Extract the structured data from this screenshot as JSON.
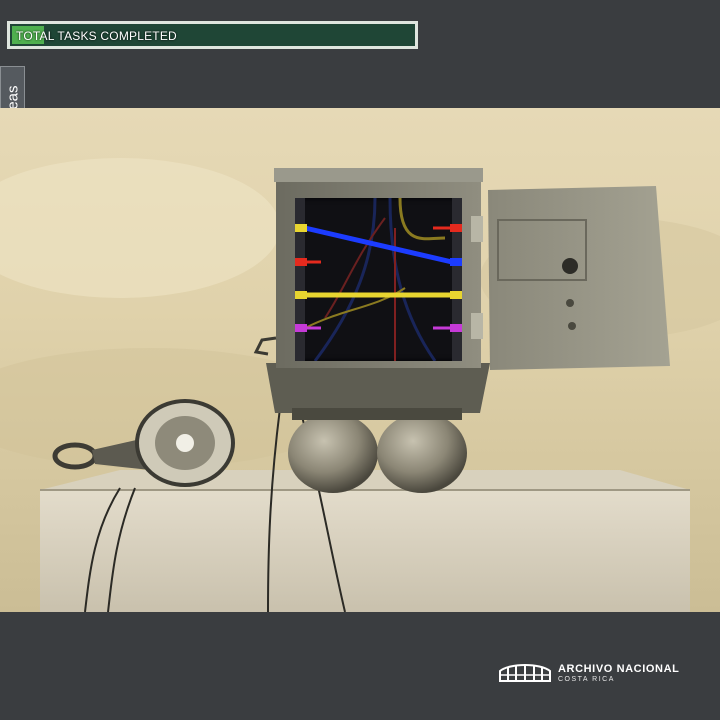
{
  "header": {
    "progress_label": "TOTAL TASKS COMPLETED",
    "progress_fraction": 0.08
  },
  "sidebar": {
    "tab_label": "Tareas"
  },
  "task": {
    "wires": [
      {
        "color": "#1c3cff",
        "from": "left-1",
        "to": "right-2"
      },
      {
        "color": "#e8d530",
        "from": "left-3",
        "to": "right-3"
      }
    ],
    "left_connector_colors": [
      "#e8d530",
      "#e52a1e",
      "#e8d530",
      "#c63ad8"
    ],
    "right_connector_colors": [
      "#e52a1e",
      "#1c3cff",
      "#e8d530",
      "#c63ad8"
    ]
  },
  "footer": {
    "logo_name": "ARCHIVO NACIONAL",
    "logo_sub": "COSTA RICA"
  },
  "colors": {
    "background": "#3a3d40",
    "progress_fill": "#4fb04f",
    "progress_track": "#1f4636"
  }
}
